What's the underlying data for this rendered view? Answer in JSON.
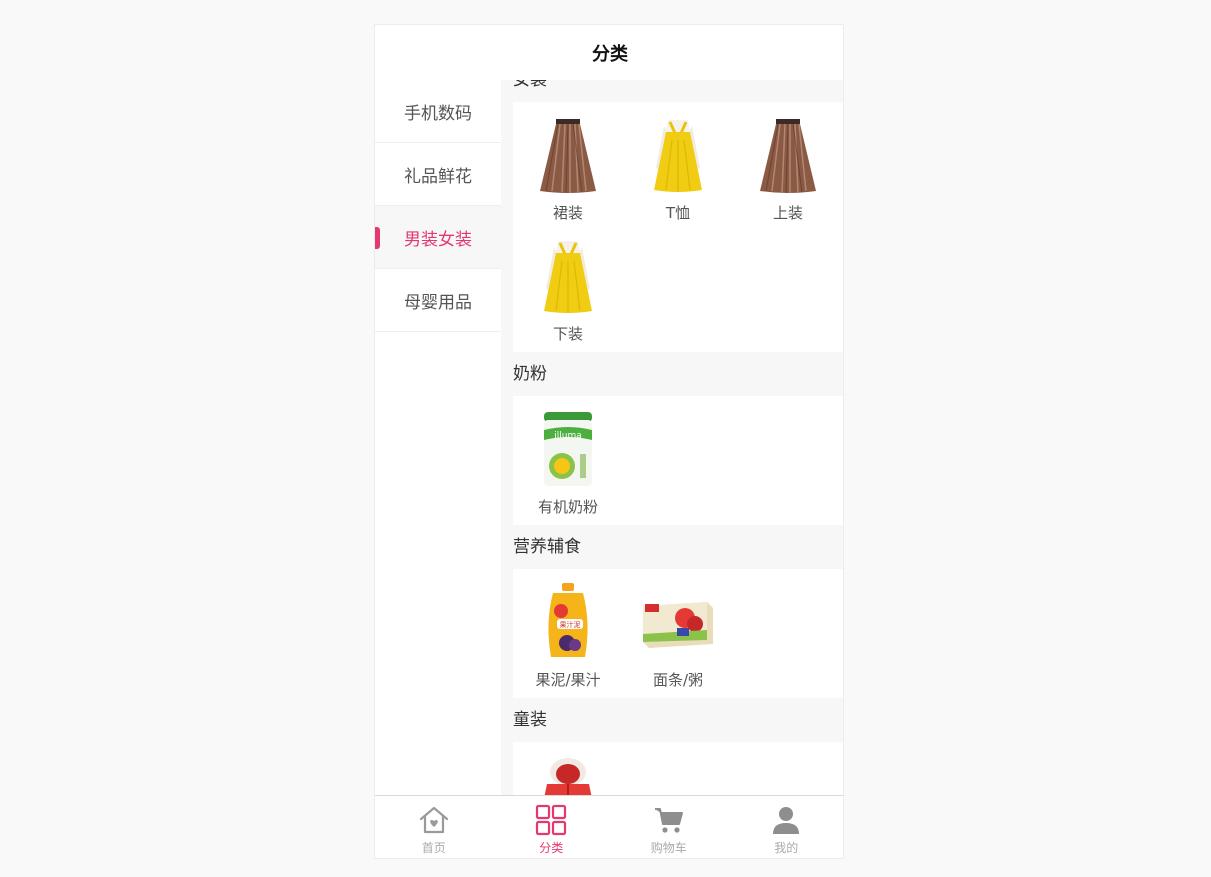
{
  "header": {
    "title": "分类"
  },
  "sidebar": {
    "items": [
      {
        "label": "手机数码",
        "active": false
      },
      {
        "label": "礼品鲜花",
        "active": false
      },
      {
        "label": "男装女装",
        "active": true
      },
      {
        "label": "母婴用品",
        "active": false
      }
    ]
  },
  "content": {
    "sections": [
      {
        "title": "女装",
        "items": [
          {
            "label": "裙装",
            "icon": "skirt-image"
          },
          {
            "label": "T恤",
            "icon": "dress-image"
          },
          {
            "label": "上装",
            "icon": "skirt-image"
          },
          {
            "label": "下装",
            "icon": "dress-image"
          }
        ]
      },
      {
        "title": "奶粉",
        "items": [
          {
            "label": "有机奶粉",
            "icon": "milk-powder-can-image"
          }
        ]
      },
      {
        "title": "营养辅食",
        "items": [
          {
            "label": "果泥/果汁",
            "icon": "fruit-pouch-image"
          },
          {
            "label": "面条/粥",
            "icon": "noodle-box-image"
          }
        ]
      },
      {
        "title": "童装",
        "items": [
          {
            "label": "",
            "icon": "kids-jacket-image"
          }
        ]
      }
    ]
  },
  "tabbar": {
    "tabs": [
      {
        "label": "首页",
        "icon": "home-icon",
        "active": false
      },
      {
        "label": "分类",
        "icon": "category-grid-icon",
        "active": true
      },
      {
        "label": "购物车",
        "icon": "cart-icon",
        "active": false
      },
      {
        "label": "我的",
        "icon": "user-icon",
        "active": false
      }
    ]
  },
  "colors": {
    "accent": "#e5386d",
    "inactive": "#aaaaaa",
    "background": "#f7f7f7"
  }
}
